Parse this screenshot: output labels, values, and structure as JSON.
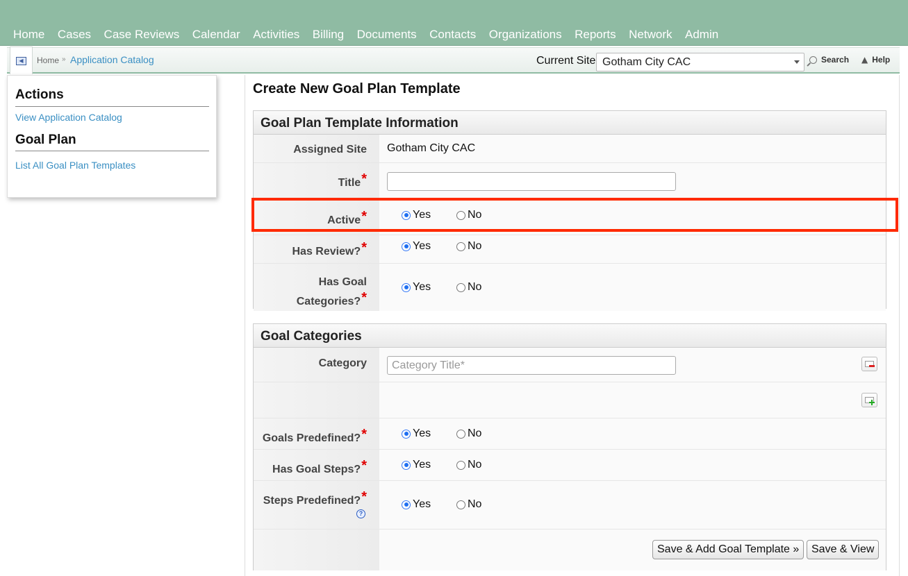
{
  "nav": {
    "items": [
      "Home",
      "Cases",
      "Case Reviews",
      "Calendar",
      "Activities",
      "Billing",
      "Documents",
      "Contacts",
      "Organizations",
      "Reports",
      "Network",
      "Admin"
    ]
  },
  "breadcrumb": {
    "home": "Home",
    "separator": "»",
    "current": "Application Catalog"
  },
  "site": {
    "label": "Current Site",
    "selected": "Gotham City CAC"
  },
  "toolbar": {
    "search": "Search",
    "help": "Help"
  },
  "sidebar": {
    "actions_heading": "Actions",
    "actions_link": "View Application Catalog",
    "goalplan_heading": "Goal Plan",
    "goalplan_link": "List All Goal Plan Templates"
  },
  "page": {
    "title": "Create New Goal Plan Template"
  },
  "info_section": {
    "heading": "Goal Plan Template Information",
    "assigned_site_label": "Assigned Site",
    "assigned_site_value": "Gotham City CAC",
    "title_label": "Title",
    "title_value": "",
    "active_label": "Active",
    "has_review_label": "Has Review?",
    "has_goal_categories_label_1": "Has Goal",
    "has_goal_categories_label_2": "Categories?"
  },
  "categories_section": {
    "heading": "Goal Categories",
    "category_label": "Category",
    "category_placeholder": "Category Title*",
    "goals_predefined_label": "Goals Predefined?",
    "has_goal_steps_label": "Has Goal Steps?",
    "steps_predefined_label": "Steps Predefined?"
  },
  "radio": {
    "yes": "Yes",
    "no": "No"
  },
  "required_mark": "*",
  "help_glyph": "?",
  "buttons": {
    "save_add": "Save & Add Goal Template »",
    "save_view": "Save & View"
  },
  "colors": {
    "nav_bg": "#8fbba3",
    "link": "#3a8fc3",
    "required": "#e00000",
    "highlight": "#ff2a00"
  }
}
